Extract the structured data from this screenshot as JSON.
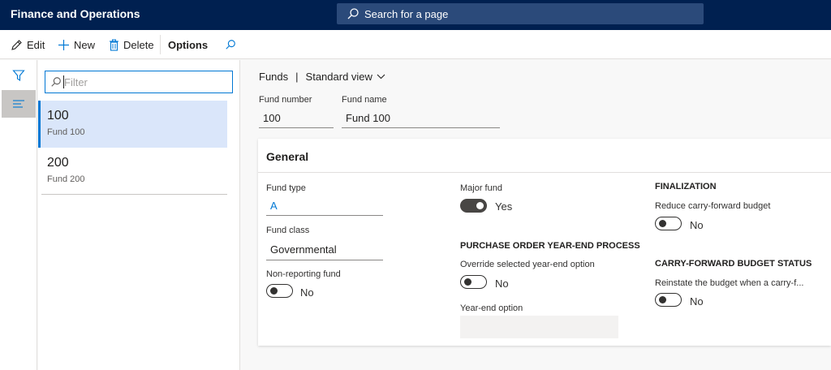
{
  "app": {
    "title": "Finance and Operations"
  },
  "search": {
    "placeholder": "Search for a page"
  },
  "actions": {
    "edit": "Edit",
    "new": "New",
    "delete": "Delete",
    "options": "Options"
  },
  "filter": {
    "placeholder": "Filter"
  },
  "records": [
    {
      "number": "100",
      "name": "Fund 100",
      "selected": true
    },
    {
      "number": "200",
      "name": "Fund 200",
      "selected": false
    }
  ],
  "breadcrumb": {
    "page": "Funds",
    "separator": "|",
    "view": "Standard view"
  },
  "header_fields": {
    "fund_number_label": "Fund number",
    "fund_number": "100",
    "fund_name_label": "Fund name",
    "fund_name": "Fund 100"
  },
  "general": {
    "title": "General",
    "fund_type_label": "Fund type",
    "fund_type": "A",
    "fund_class_label": "Fund class",
    "fund_class": "Governmental",
    "non_reporting_label": "Non-reporting fund",
    "non_reporting": "No",
    "major_fund_label": "Major fund",
    "major_fund": "Yes",
    "po_section": "PURCHASE ORDER YEAR-END PROCESS",
    "override_label": "Override selected year-end option",
    "override": "No",
    "yearend_option_label": "Year-end option",
    "finalization_section": "FINALIZATION",
    "reduce_label": "Reduce carry-forward budget",
    "reduce": "No",
    "cf_section": "CARRY-FORWARD BUDGET STATUS",
    "reinstate_label": "Reinstate the budget when a carry-f...",
    "reinstate": "No"
  },
  "colors": {
    "nav": "#002050",
    "accent": "#0078d4",
    "selected_row": "#dae6fa"
  }
}
